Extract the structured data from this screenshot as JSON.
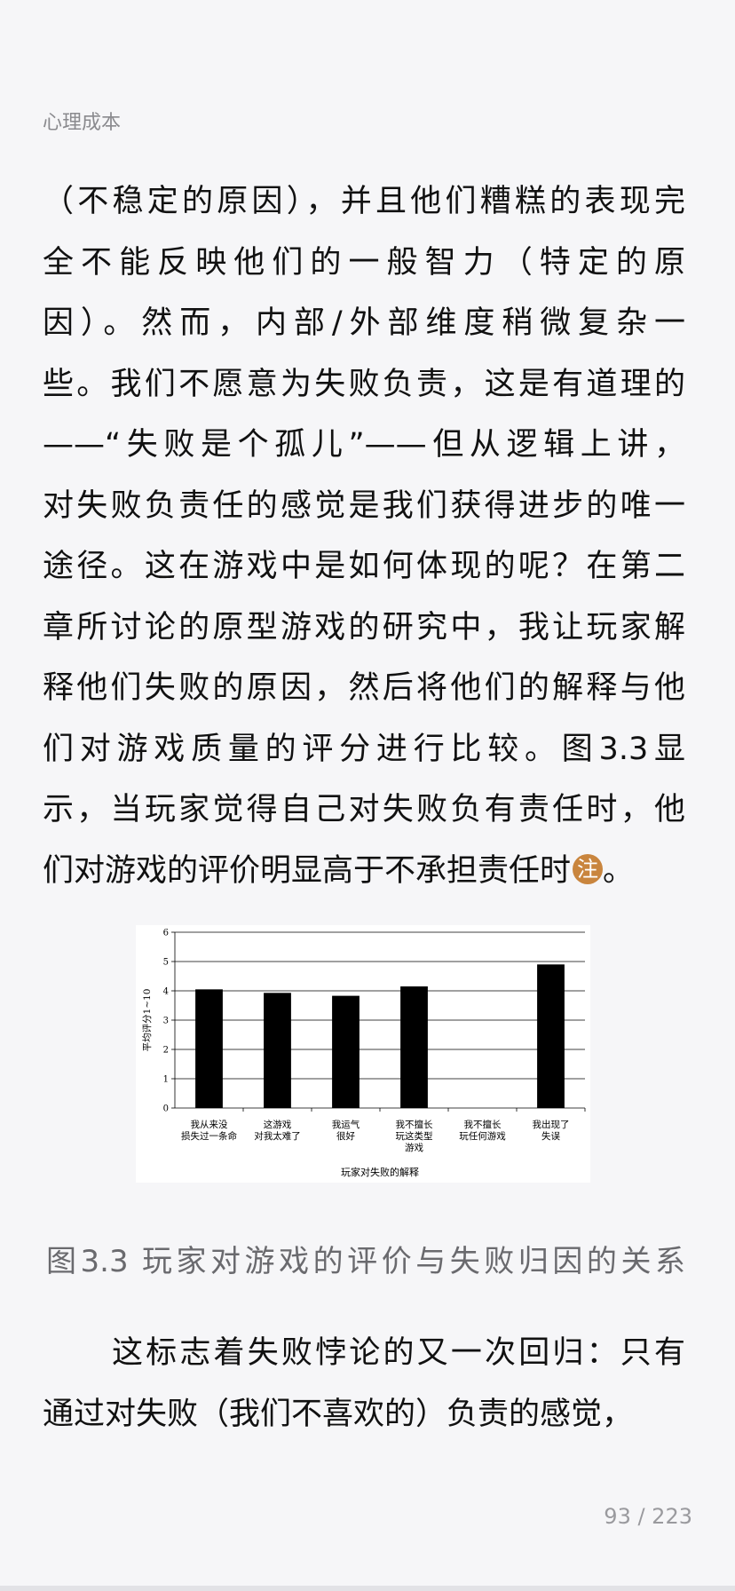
{
  "header": {
    "title": "心理成本"
  },
  "paragraph1": {
    "lines": [
      "（不稳定的原因），并且他们糟糕的表现完",
      "全不能反映他们的一般智力（特定的原",
      "因）。然而，内部/外部维度稍微复杂一",
      "些。我们不愿意为失败负责，这是有道理的",
      "——“失败是个孤儿”——但从逻辑上讲，",
      "对失败负责任的感觉是我们获得进步的唯一",
      "途径。这在游戏中是如何体现的呢？在第二",
      "章所讨论的原型游戏的研究中，我让玩家解",
      "释他们失败的原因，然后将他们的解释与他",
      "们对游戏质量的评分进行比较。图3.3显",
      "示，当玩家觉得自己对失败负有责任时，他"
    ],
    "last_line": "们对游戏的评价明显高于不承担责任时",
    "note_label": "注",
    "last_line_end": "。"
  },
  "chart_data": {
    "type": "bar",
    "categories": [
      [
        "我从来没",
        "损失过一条命"
      ],
      [
        "这游戏",
        "对我太难了"
      ],
      [
        "我运气",
        "很好"
      ],
      [
        "我不擅长",
        "玩这类型",
        "游戏"
      ],
      [
        "我不擅长",
        "玩任何游戏"
      ],
      [
        "我出现了",
        "失误"
      ]
    ],
    "values": [
      4.05,
      3.93,
      3.83,
      4.15,
      null,
      4.9
    ],
    "ylim": [
      0,
      6
    ],
    "yticks": [
      0,
      1,
      2,
      3,
      4,
      5,
      6
    ],
    "ylabel": "平均评分1~10",
    "xlabel": "玩家对失败的解释",
    "grid": true,
    "bar_color": "#000000"
  },
  "caption": "图3.3 玩家对游戏的评价与失败归因的关系",
  "paragraph2": {
    "lines": [
      "这标志着失败悖论的又一次回归：只有",
      "通过对失败（我们不喜欢的）负责的感觉，"
    ]
  },
  "footer": {
    "page": "93 / 223"
  },
  "colors": {
    "note_badge": "#c9853e",
    "caption": "#6a6a6e",
    "background": "#f6f6f8"
  }
}
